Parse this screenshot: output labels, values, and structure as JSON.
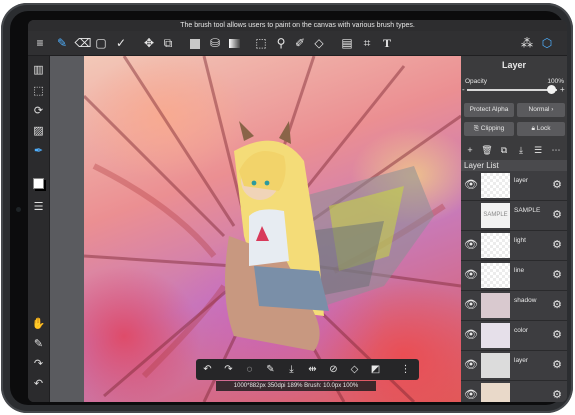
{
  "hint_text": "The brush tool allows users to paint on the canvas with various brush types.",
  "toolbar": {
    "icons": [
      "menu-icon",
      "brush-icon",
      "eraser-icon",
      "square-icon",
      "smudge-icon",
      "move-icon",
      "transform-icon",
      "fill-color-swatch",
      "bucket-icon",
      "gradient-icon",
      "selection-rect-icon",
      "magic-wand-icon",
      "select-pen-icon",
      "select-eraser-icon",
      "layout-icon",
      "crop-icon",
      "text-icon",
      "material-icon",
      "3d-icon"
    ],
    "active": "brush-icon",
    "text_label": "T"
  },
  "leftbar": {
    "icons": [
      "pages-icon",
      "selection-icon",
      "rotate-icon",
      "ruler-icon",
      "pen-settings-icon",
      "color-icon",
      "layers-list-icon",
      "hand-icon",
      "eyedropper-icon",
      "redo-icon",
      "undo-icon"
    ],
    "active": "pen-settings-icon"
  },
  "quickbar": {
    "icons": [
      "undo-icon",
      "redo-icon",
      "lasso-icon",
      "pen-icon",
      "save-icon",
      "flip-icon",
      "deselect-icon",
      "clear-icon",
      "invert-icon",
      "grip-icon"
    ]
  },
  "status_info": "1000*882px 350dpi 189% Brush: 10.0px 100%",
  "layer_panel": {
    "title": "Layer",
    "opacity_label": "Opacity",
    "opacity_value": "100%",
    "opacity": 1.0,
    "protect_alpha_label": "Protect Alpha",
    "blend_mode": "Normal",
    "clipping_label": "Clipping",
    "lock_label": "Lock",
    "list_title": "Layer List",
    "layers": [
      {
        "name": "layer",
        "visible": true
      },
      {
        "name": "SAMPLE",
        "visible": false,
        "thumb_text": "SAMPLE"
      },
      {
        "name": "light",
        "visible": true
      },
      {
        "name": "line",
        "visible": true
      },
      {
        "name": "shadow",
        "visible": true
      },
      {
        "name": "color",
        "visible": true
      },
      {
        "name": "layer",
        "visible": true
      },
      {
        "name": "",
        "visible": true
      }
    ]
  },
  "colors": {
    "accent": "#4fb0ff",
    "panel_bg": "#3b3b3d",
    "toolbar_bg": "#303032"
  }
}
